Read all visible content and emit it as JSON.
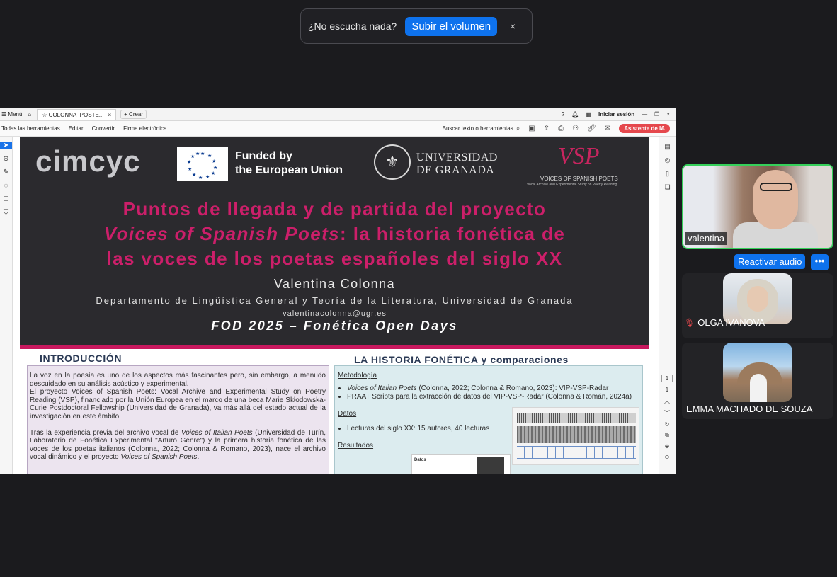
{
  "banner": {
    "message": "¿No escucha nada?",
    "button": "Subir el volumen",
    "close": "×"
  },
  "window": {
    "menu": "Menú",
    "home_icon": "⌂",
    "tab_title": "COLONNA_POSTE...",
    "tab_close": "×",
    "new_tab": "+ Crear",
    "sign_in": "Iniciar sesión",
    "help_icon": "?",
    "minimize": "—",
    "restore": "❐",
    "close": "×"
  },
  "toolbar": {
    "all_tools": "Todas las herramientas",
    "edit": "Editar",
    "convert": "Convertir",
    "sign": "Firma electrónica",
    "search": "Buscar texto o herramientas",
    "ai_assistant": "Asistente de IA"
  },
  "page_nav": {
    "current": "1",
    "total": "1"
  },
  "poster": {
    "logo_cimcyc": "cimcyc",
    "eu_line1": "Funded by",
    "eu_line2": "the European Union",
    "ugr_line1": "UNIVERSIDAD",
    "ugr_line2": "DE GRANADA",
    "vsp_mark": "VSP",
    "vsp_title": "VOICES OF SPANISH POETS",
    "vsp_subtitle": "Vocal Archive and Experimental Study on Poetry Reading",
    "title_line1": "Puntos de llegada y de partida del proyecto",
    "title_line2_italic": "Voices of Spanish Poets",
    "title_line2_rest": ": la historia fonética de",
    "title_line3": "las voces de los poetas españoles del siglo XX",
    "author": "Valentina Colonna",
    "department": "Departamento de Lingüística General y Teoría de la Literatura, Universidad de Granada",
    "email": "valentinacolonna@ugr.es",
    "event": "FOD 2025 – Fonética Open Days",
    "intro_heading": "INTRODUCCIÓN",
    "intro_p1": "La voz en la poesía es uno de los aspectos más fascinantes pero, sin embargo, a menudo descuidado en su análisis acústico y experimental.",
    "intro_p2": "El proyecto Voices of Spanish Poets: Vocal Archive and Experimental Study on Poetry Reading (VSP), financiado por la Unión Europea en el marco de una beca Marie Skłodowska-Curie Postdoctoral Fellowship (Universidad de Granada), va más allá del estado actual de la investigación en este ámbito.",
    "intro_p3_a": "Tras la experiencia previa del archivo vocal de ",
    "intro_p3_italic": "Voices of Italian Poets",
    "intro_p3_b": " (Universidad de Turín, Laboratorio de Fonética Experimental \"Arturo Genre\") y la primera historia fonética de las voces de los poetas italianos (Colonna, 2022; Colonna & Romano, 2023), nace el archivo vocal dinámico y el proyecto ",
    "intro_p3_italic2": "Voices of Spanish Poets",
    "intro_p3_c": ".",
    "hist_heading": "LA HISTORIA FONÉTICA y comparaciones",
    "method_label": "Metodología",
    "method_item1_italic": "Voices of Italian Poets",
    "method_item1_rest": " (Colonna, 2022; Colonna & Romano, 2023): VIP-VSP-Radar",
    "method_item2": "PRAAT Scripts para la extracción de datos del VIP-VSP-Radar (Colonna & Román, 2024a)",
    "data_label": "Datos",
    "data_item1": "Lecturas del siglo XX: 15 autores, 40 lecturas",
    "results_label": "Resultados",
    "datos_card_title": "Datos"
  },
  "participants": [
    {
      "name": "valentina"
    },
    {
      "name": "OLGA IVANOVA"
    },
    {
      "name": "EMMA MACHADO DE SOUZA"
    }
  ],
  "controls": {
    "unmute": "Reactivar audio",
    "more": "•••"
  }
}
